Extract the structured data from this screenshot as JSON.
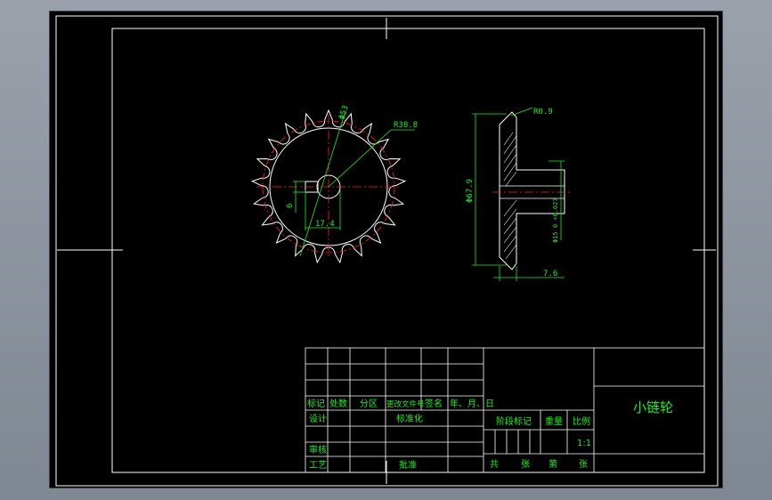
{
  "title_block": {
    "part_name": "小链轮",
    "row_marks": {
      "c1": "标记",
      "c2": "处数",
      "c3": "分区",
      "c4": "更改文件号",
      "c5": "签名",
      "c6": "年、月、日"
    },
    "design": "设计",
    "standardize": "标准化",
    "review": "审核",
    "process": "工艺",
    "approve": "批准",
    "stage_mark": "阶段标记",
    "weight": "重量",
    "scale_label": "比例",
    "scale_value": "1:1",
    "total": "共",
    "sheets1": "张",
    "number": "第",
    "sheets2": "张"
  },
  "dimensions": {
    "tip_dia": "Φ53",
    "root_radius": "R38.8",
    "keyway_height": "17.4",
    "keyway_width": "6",
    "roller_radius": "R0.9",
    "pitch_dia": "Φ67.9",
    "hub_dia": "Φ15 0  +0.027",
    "thickness": "7.6"
  },
  "colors": {
    "line": "#ffffff",
    "dim": "#1ef01e",
    "center": "#ff2020",
    "text": "#1ef01e",
    "bg": "#000000"
  }
}
